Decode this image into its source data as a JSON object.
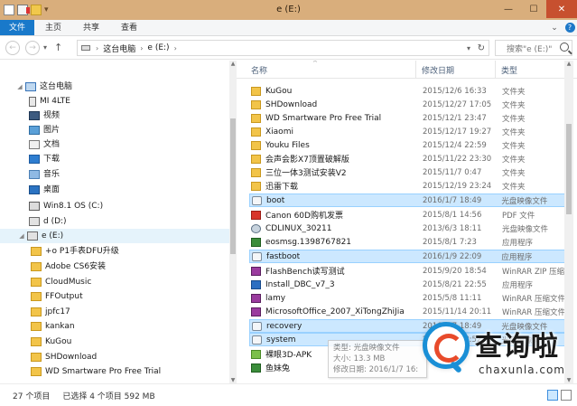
{
  "window": {
    "title": "e (E:)"
  },
  "ribbon": {
    "tabs": [
      {
        "label": "文件",
        "active": true
      },
      {
        "label": "主页"
      },
      {
        "label": "共享"
      },
      {
        "label": "查看"
      }
    ]
  },
  "address": {
    "crumbs": [
      "这台电脑",
      "e (E:)"
    ],
    "search_placeholder": "搜索\"e (E:)\""
  },
  "nav": {
    "items": [
      {
        "label": "这台电脑",
        "icon": "pc-icon",
        "indent": 1,
        "twisty": "◢"
      },
      {
        "label": "MI 4LTE",
        "icon": "device-icon",
        "indent": 2,
        "twisty": ""
      },
      {
        "label": "视频",
        "icon": "video-icon",
        "indent": 2,
        "twisty": ""
      },
      {
        "label": "图片",
        "icon": "pictures-icon",
        "indent": 2,
        "twisty": ""
      },
      {
        "label": "文档",
        "icon": "documents-icon",
        "indent": 2,
        "twisty": ""
      },
      {
        "label": "下载",
        "icon": "downloads-icon",
        "indent": 2,
        "twisty": ""
      },
      {
        "label": "音乐",
        "icon": "music-icon",
        "indent": 2,
        "twisty": ""
      },
      {
        "label": "桌面",
        "icon": "desktop-icon",
        "indent": 2,
        "twisty": ""
      },
      {
        "label": "Win8.1 OS (C:)",
        "icon": "windows-drive-icon",
        "indent": 2,
        "twisty": ""
      },
      {
        "label": "d (D:)",
        "icon": "drive-icon",
        "indent": 2,
        "twisty": ""
      },
      {
        "label": "e (E:)",
        "icon": "drive-icon",
        "indent": 2,
        "twisty": "◢",
        "selected": true
      },
      {
        "label": "+o P1手表DFU升级",
        "icon": "folder-icon",
        "indent": 3,
        "twisty": ""
      },
      {
        "label": "Adobe CS6安装",
        "icon": "folder-icon",
        "indent": 3,
        "twisty": ""
      },
      {
        "label": "CloudMusic",
        "icon": "folder-icon",
        "indent": 3,
        "twisty": ""
      },
      {
        "label": "FFOutput",
        "icon": "folder-icon",
        "indent": 3,
        "twisty": ""
      },
      {
        "label": "jpfc17",
        "icon": "folder-icon",
        "indent": 3,
        "twisty": ""
      },
      {
        "label": "kankan",
        "icon": "folder-icon",
        "indent": 3,
        "twisty": ""
      },
      {
        "label": "KuGou",
        "icon": "folder-icon",
        "indent": 3,
        "twisty": ""
      },
      {
        "label": "SHDownload",
        "icon": "folder-icon",
        "indent": 3,
        "twisty": ""
      },
      {
        "label": "WD Smartware Pro Free Trial",
        "icon": "folder-icon",
        "indent": 3,
        "twisty": ""
      }
    ]
  },
  "list": {
    "columns": {
      "name": "名称",
      "date": "修改日期",
      "type": "类型"
    },
    "rows": [
      {
        "name": "KuGou",
        "date": "2015/12/6 16:33",
        "type": "文件夹",
        "icon": "folder-icon"
      },
      {
        "name": "SHDownload",
        "date": "2015/12/27 17:05",
        "type": "文件夹",
        "icon": "folder-icon"
      },
      {
        "name": "WD Smartware Pro Free Trial",
        "date": "2015/12/1 23:47",
        "type": "文件夹",
        "icon": "folder-icon"
      },
      {
        "name": "Xiaomi",
        "date": "2015/12/17 19:27",
        "type": "文件夹",
        "icon": "folder-icon"
      },
      {
        "name": "Youku Files",
        "date": "2015/12/4 22:59",
        "type": "文件夹",
        "icon": "folder-icon"
      },
      {
        "name": "会声会影X7顶置破解版",
        "date": "2015/11/22 23:30",
        "type": "文件夹",
        "icon": "folder-icon"
      },
      {
        "name": "三位一体3测试安装V2",
        "date": "2015/11/7 0:47",
        "type": "文件夹",
        "icon": "folder-icon"
      },
      {
        "name": "迅雷下载",
        "date": "2015/12/19 23:24",
        "type": "文件夹",
        "icon": "folder-icon"
      },
      {
        "name": "boot",
        "date": "2016/1/7 18:49",
        "type": "光盘映像文件",
        "icon": "disc-image-icon",
        "selected": true
      },
      {
        "name": "Canon 60D购机发票",
        "date": "2015/8/1 14:56",
        "type": "PDF 文件",
        "icon": "pdf-icon"
      },
      {
        "name": "CDLINUX_30211",
        "date": "2013/6/3 18:11",
        "type": "光盘映像文件",
        "icon": "disc-image-icon"
      },
      {
        "name": "eosmsg.1398767821",
        "date": "2015/8/1 7:23",
        "type": "应用程序",
        "icon": "app-icon"
      },
      {
        "name": "fastboot",
        "date": "2016/1/9 22:09",
        "type": "应用程序",
        "icon": "app-icon",
        "selected": true
      },
      {
        "name": "FlashBench读写测试",
        "date": "2015/9/20 18:54",
        "type": "WinRAR ZIP 压缩文件",
        "icon": "archive-icon"
      },
      {
        "name": "Install_DBC_v7_3",
        "date": "2015/8/21 22:55",
        "type": "应用程序",
        "icon": "installer-icon"
      },
      {
        "name": "lamy",
        "date": "2015/5/8 11:11",
        "type": "WinRAR 压缩文件",
        "icon": "archive-icon"
      },
      {
        "name": "MicrosoftOffice_2007_XiTongZhiJia",
        "date": "2015/11/14 20:11",
        "type": "WinRAR 压缩文件",
        "icon": "archive-icon"
      },
      {
        "name": "recovery",
        "date": "2016/1/7 18:49",
        "type": "光盘映像文件",
        "icon": "disc-image-icon",
        "selected": true
      },
      {
        "name": "system",
        "date": "2016/1/7 18:52",
        "type": "光盘映像文件",
        "icon": "disc-image-icon",
        "selected": true
      },
      {
        "name": "裸眼3D-APK",
        "date": "",
        "type": "",
        "icon": "apk-icon"
      },
      {
        "name": "鱼妹兔",
        "date": "",
        "type": "",
        "icon": "app-icon"
      }
    ]
  },
  "tooltip": {
    "type_line": "类型: 光盘映像文件",
    "size_line": "大小: 13.3 MB",
    "date_line": "修改日期: 2016/1/7 16:"
  },
  "status": {
    "count": "27 个项目",
    "selected": "已选择 4 个项目  592 MB"
  },
  "watermark": {
    "text": "查询啦",
    "domain": "chaxunla.com"
  }
}
